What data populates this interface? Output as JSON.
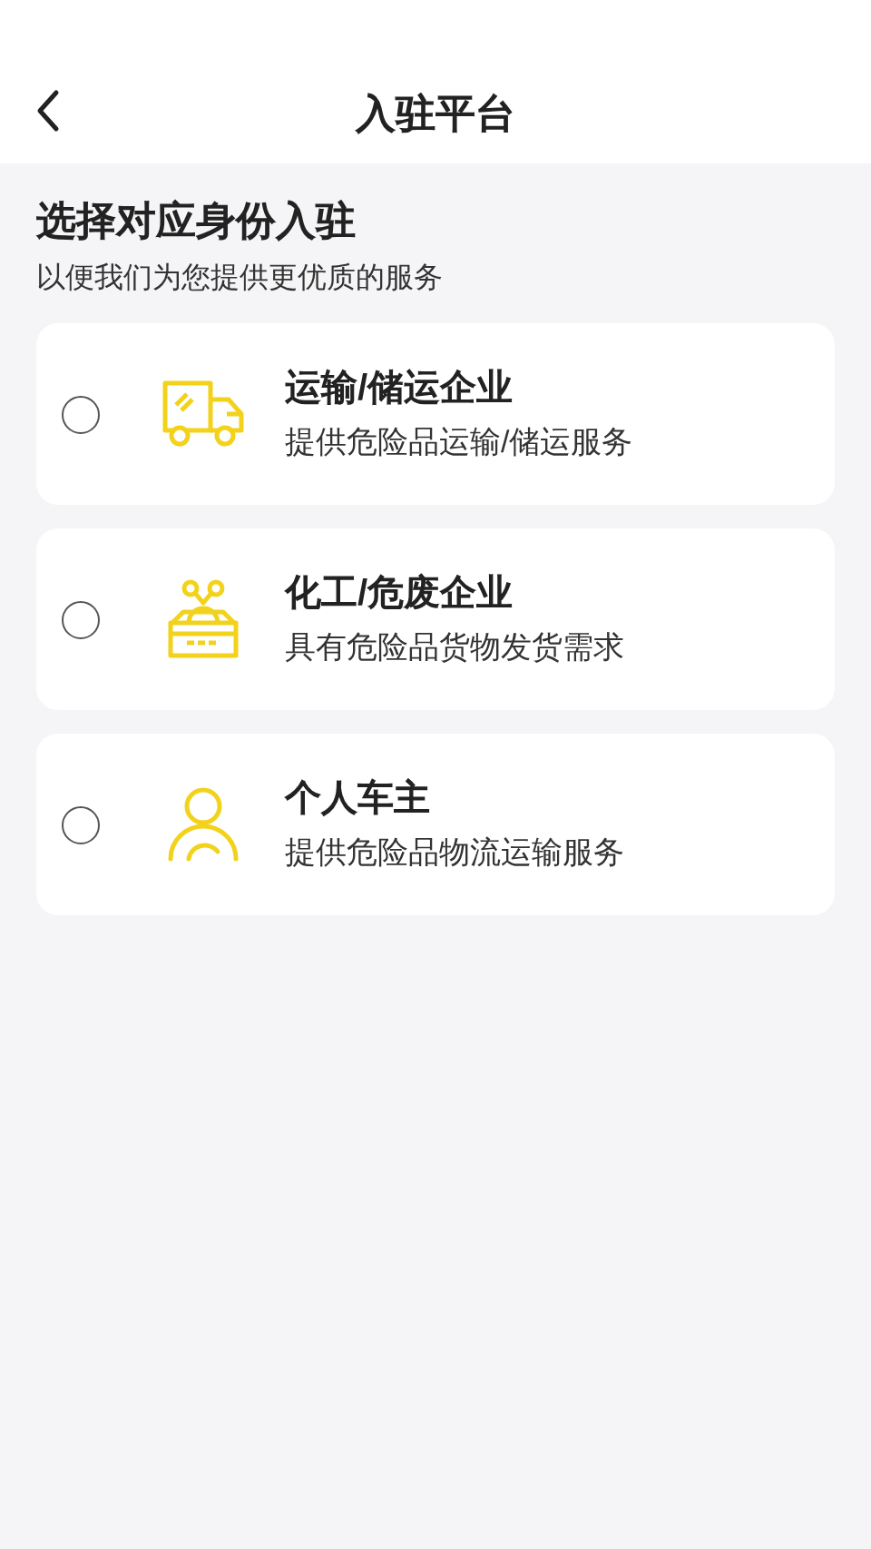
{
  "header": {
    "title": "入驻平台"
  },
  "heading": "选择对应身份入驻",
  "subheading": "以便我们为您提供更优质的服务",
  "options": [
    {
      "kind": "truck",
      "title": "运输/储运企业",
      "description": "提供危险品运输/储运服务",
      "selected": false
    },
    {
      "kind": "chemical",
      "title": "化工/危废企业",
      "description": "具有危险品货物发货需求",
      "selected": false
    },
    {
      "kind": "person",
      "title": "个人车主",
      "description": "提供危险品物流运输服务",
      "selected": false
    }
  ]
}
